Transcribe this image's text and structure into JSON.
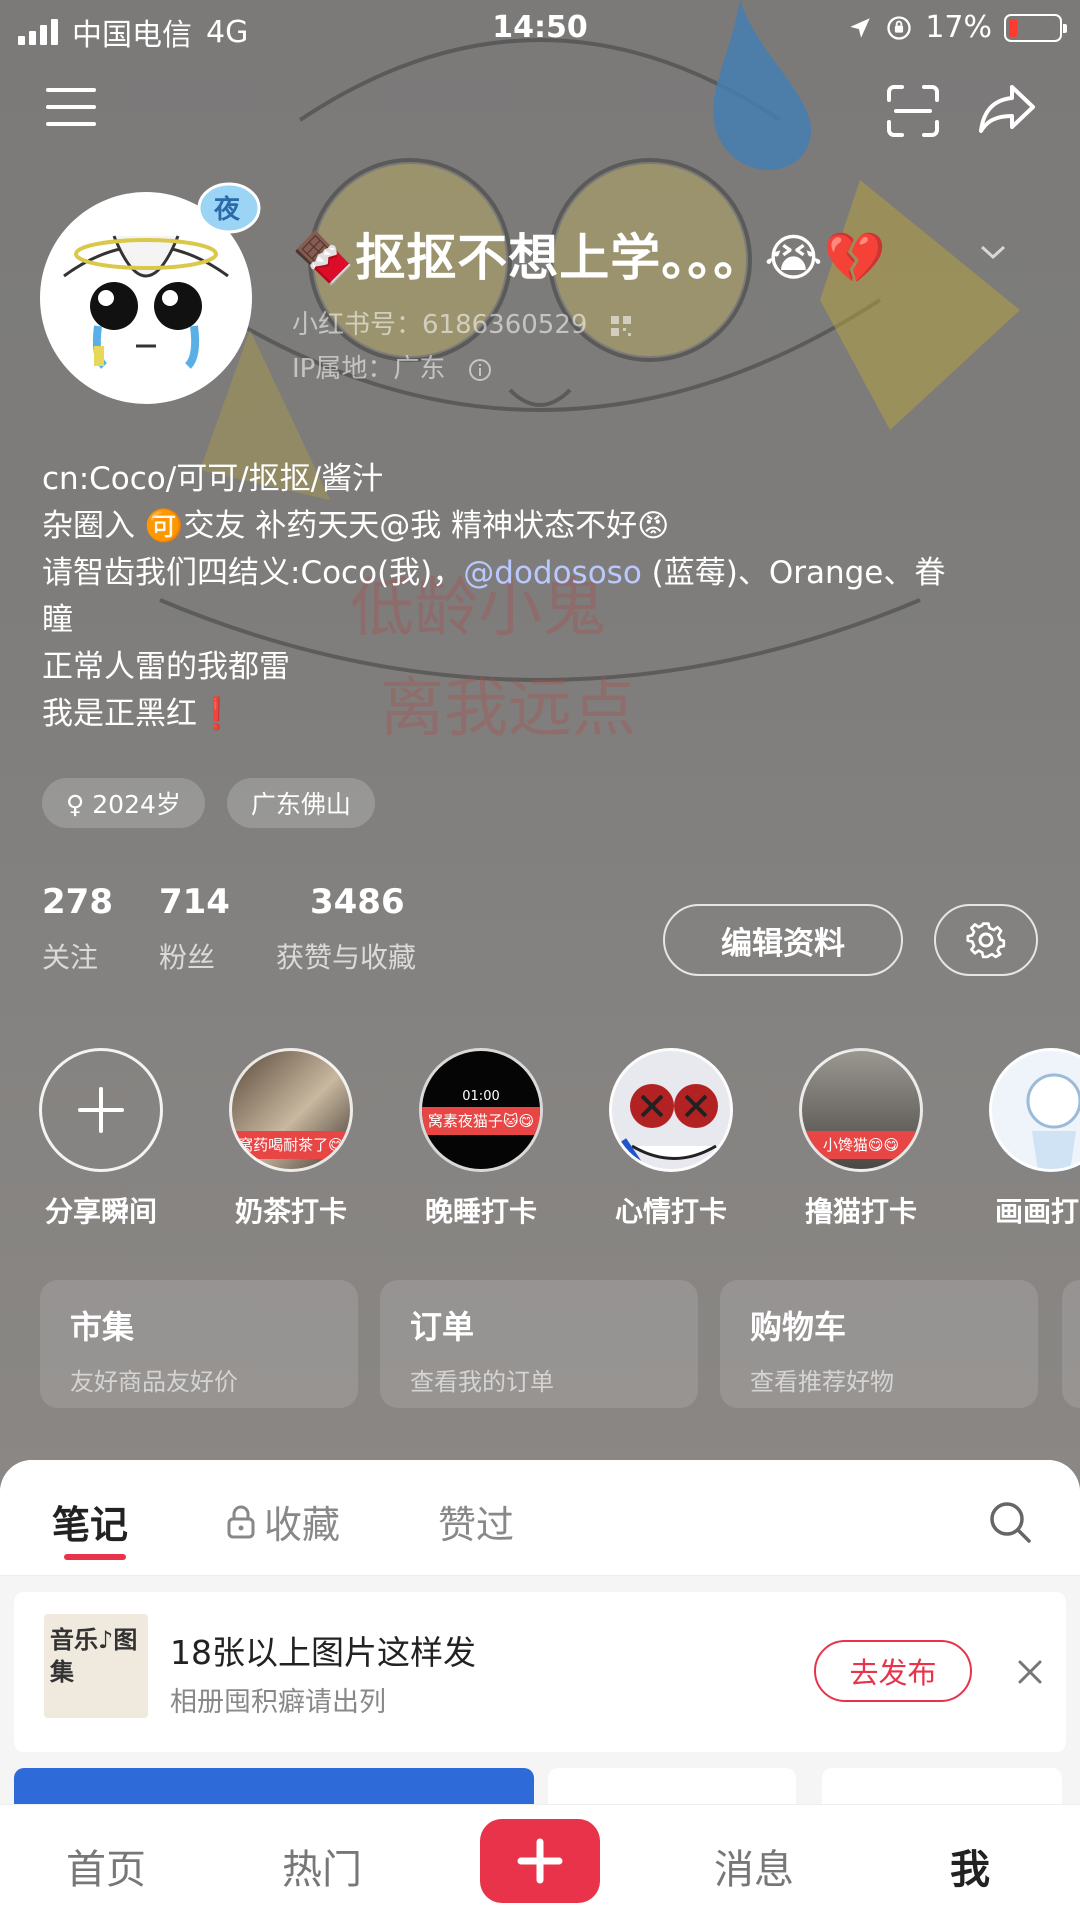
{
  "status_bar": {
    "carrier": "中国电信",
    "network": "4G",
    "time": "14:50",
    "battery": "17%"
  },
  "profile": {
    "nickname": "🍫抠抠不想上学。。。😭💔",
    "red_id": "小红书号：6186360529",
    "ip_location": "IP属地：广东",
    "bio_lines": [
      "cn:Coco/可可/抠抠/酱汁",
      "杂圈入 🉑交友 补药天天@我 精神状态不好😡",
      "请智齿我们四结义:Coco(我)，",
      "@dodososo",
      "(蓝莓)、Orange、眷",
      "瞳",
      "正常人雷的我都雷",
      "我是正黑红❗"
    ],
    "tags": [
      "♀ 2024岁",
      "广东佛山"
    ],
    "stats": [
      {
        "num": "278",
        "label": "关注"
      },
      {
        "num": "714",
        "label": "粉丝"
      },
      {
        "num": "3486",
        "label": "获赞与收藏"
      }
    ],
    "edit_label": "编辑资料"
  },
  "highlights": [
    {
      "label": "分享瞬间"
    },
    {
      "label": "奶茶打卡",
      "ribbon": "窝药喝耐茶了😋"
    },
    {
      "label": "晚睡打卡",
      "ribbon": "窝素夜猫子🐱😋",
      "time": "01:00"
    },
    {
      "label": "心情打卡"
    },
    {
      "label": "撸猫打卡",
      "ribbon": "小馋猫😋😋"
    },
    {
      "label": "画画打卡"
    }
  ],
  "cards": [
    {
      "title": "市集",
      "sub": "友好商品友好价"
    },
    {
      "title": "订单",
      "sub": "查看我的订单"
    },
    {
      "title": "购物车",
      "sub": "查看推荐好物"
    }
  ],
  "tabs": {
    "notes": "笔记",
    "collect": "收藏",
    "liked": "赞过"
  },
  "promo": {
    "title": "18张以上图片这样发",
    "sub": "相册囤积癖请出列",
    "button": "去发布",
    "thumb_text": "音乐♪图集"
  },
  "bottom_nav": {
    "home": "首页",
    "hot": "热门",
    "messages": "消息",
    "me": "我"
  },
  "colors": {
    "accent": "#e8334a",
    "mention": "#b9c8ff"
  }
}
